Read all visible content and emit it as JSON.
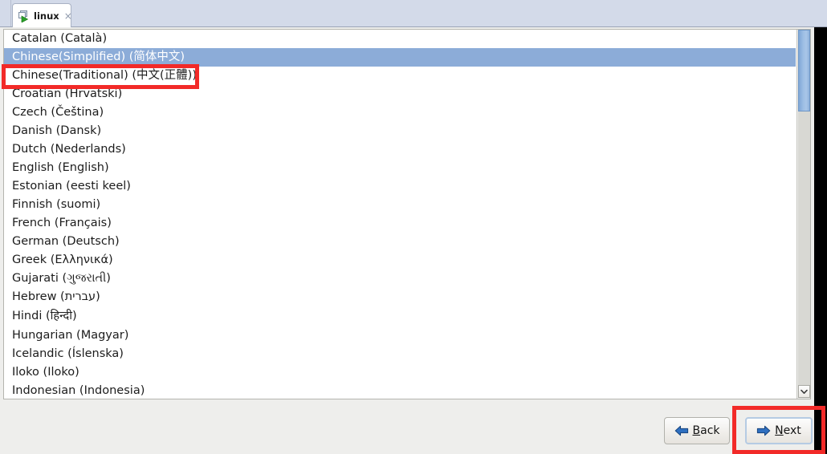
{
  "window": {
    "tab": {
      "label": "linux",
      "icon": "virtual-machine-icon",
      "close_label": "×"
    }
  },
  "language_list": {
    "selected_index": 1,
    "highlight_color": "#8cacd8",
    "items": [
      {
        "label": "Catalan (Català)"
      },
      {
        "label": "Chinese(Simplified) (简体中文)"
      },
      {
        "label": "Chinese(Traditional) (中文(正體))"
      },
      {
        "label": "Croatian (Hrvatski)"
      },
      {
        "label": "Czech (Čeština)"
      },
      {
        "label": "Danish (Dansk)"
      },
      {
        "label": "Dutch (Nederlands)"
      },
      {
        "label": "English (English)"
      },
      {
        "label": "Estonian (eesti keel)"
      },
      {
        "label": "Finnish (suomi)"
      },
      {
        "label": "French (Français)"
      },
      {
        "label": "German (Deutsch)"
      },
      {
        "label": "Greek (Ελληνικά)"
      },
      {
        "label": "Gujarati (ગુજરાતી)"
      },
      {
        "label": "Hebrew (עברית)"
      },
      {
        "label": "Hindi (हिन्दी)"
      },
      {
        "label": "Hungarian (Magyar)"
      },
      {
        "label": "Icelandic (Íslenska)"
      },
      {
        "label": "Iloko (Iloko)"
      },
      {
        "label": "Indonesian (Indonesia)"
      }
    ]
  },
  "scrollbar": {
    "orientation": "vertical",
    "thumb_position": "top",
    "down_arrow_icon": "chevron-down-icon"
  },
  "buttons": {
    "back": {
      "label_pre": "",
      "mnemonic": "B",
      "label_post": "ack",
      "icon": "left-arrow-icon"
    },
    "next": {
      "label_pre": "",
      "mnemonic": "N",
      "label_post": "ext",
      "icon": "right-arrow-icon"
    }
  },
  "annotations": {
    "color": "#f22a28",
    "boxes": [
      {
        "name": "chinese-traditional-row-highlight"
      },
      {
        "name": "next-button-highlight"
      }
    ]
  }
}
